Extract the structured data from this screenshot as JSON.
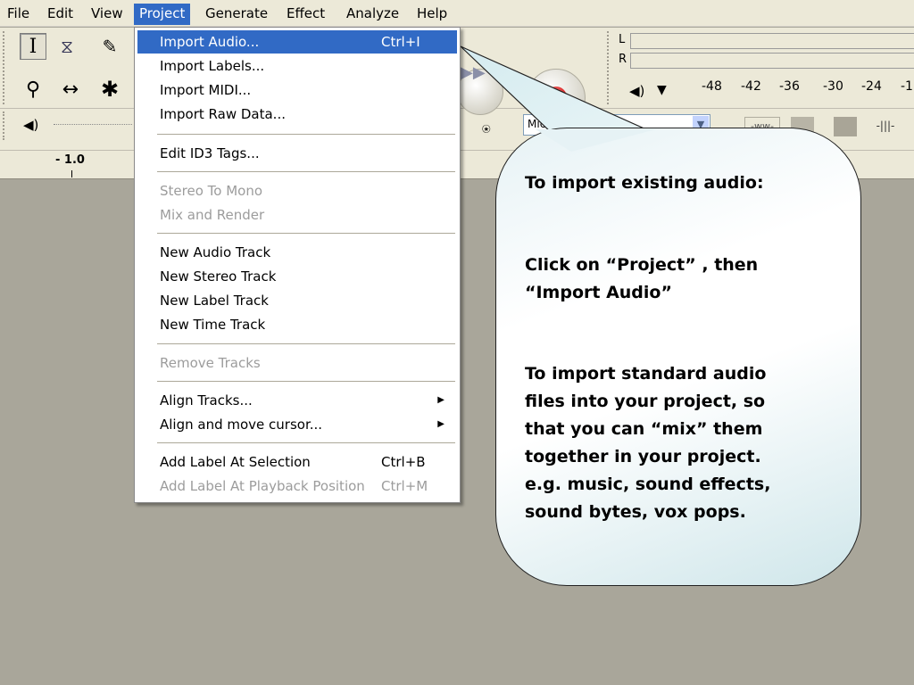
{
  "menubar": {
    "items": [
      "File",
      "Edit",
      "View",
      "Project",
      "Generate",
      "Effect",
      "Analyze",
      "Help"
    ],
    "active": "Project"
  },
  "toolbar": {
    "tools": {
      "select": "I",
      "envelope": "⧖",
      "draw": "✎",
      "zoom": "⚲",
      "timeshift": "↔",
      "multi": "✱"
    },
    "meter": {
      "left_label": "L",
      "right_label": "R",
      "scale": [
        "-48",
        "-42",
        "-36",
        "-30",
        "-24",
        "-1"
      ]
    },
    "input_source": "Mic",
    "ruler_start": "- 1.0"
  },
  "project_menu": {
    "items": [
      {
        "label": "Import Audio...",
        "shortcut": "Ctrl+I",
        "highlighted": true
      },
      {
        "label": "Import Labels..."
      },
      {
        "label": "Import MIDI..."
      },
      {
        "label": "Import Raw Data..."
      },
      {
        "label": "Edit ID3 Tags..."
      },
      {
        "label": "Stereo To Mono",
        "disabled": true
      },
      {
        "label": "Mix and Render",
        "disabled": true
      },
      {
        "label": "New Audio Track"
      },
      {
        "label": "New Stereo Track"
      },
      {
        "label": "New Label Track"
      },
      {
        "label": "New Time Track"
      },
      {
        "label": "Remove Tracks",
        "disabled": true
      },
      {
        "label": "Align Tracks...",
        "submenu": true
      },
      {
        "label": "Align and move cursor...",
        "submenu": true
      },
      {
        "label": "Add Label At Selection",
        "shortcut": "Ctrl+B"
      },
      {
        "label": "Add Label At Playback Position",
        "shortcut": "Ctrl+M",
        "disabled": true
      }
    ]
  },
  "callout": {
    "heading": "To import existing audio:",
    "line1": "Click on “Project” , then",
    "line2": "“Import Audio”",
    "body": [
      "To import standard audio",
      "files into your project, so",
      "that you can “mix” them",
      "together in your project.",
      "e.g. music, sound effects,",
      "sound bytes, vox pops."
    ]
  },
  "colors": {
    "menu_highlight": "#316ac5",
    "chrome": "#ece9d8",
    "workspace": "#a9a69a",
    "record": "#d32020"
  }
}
